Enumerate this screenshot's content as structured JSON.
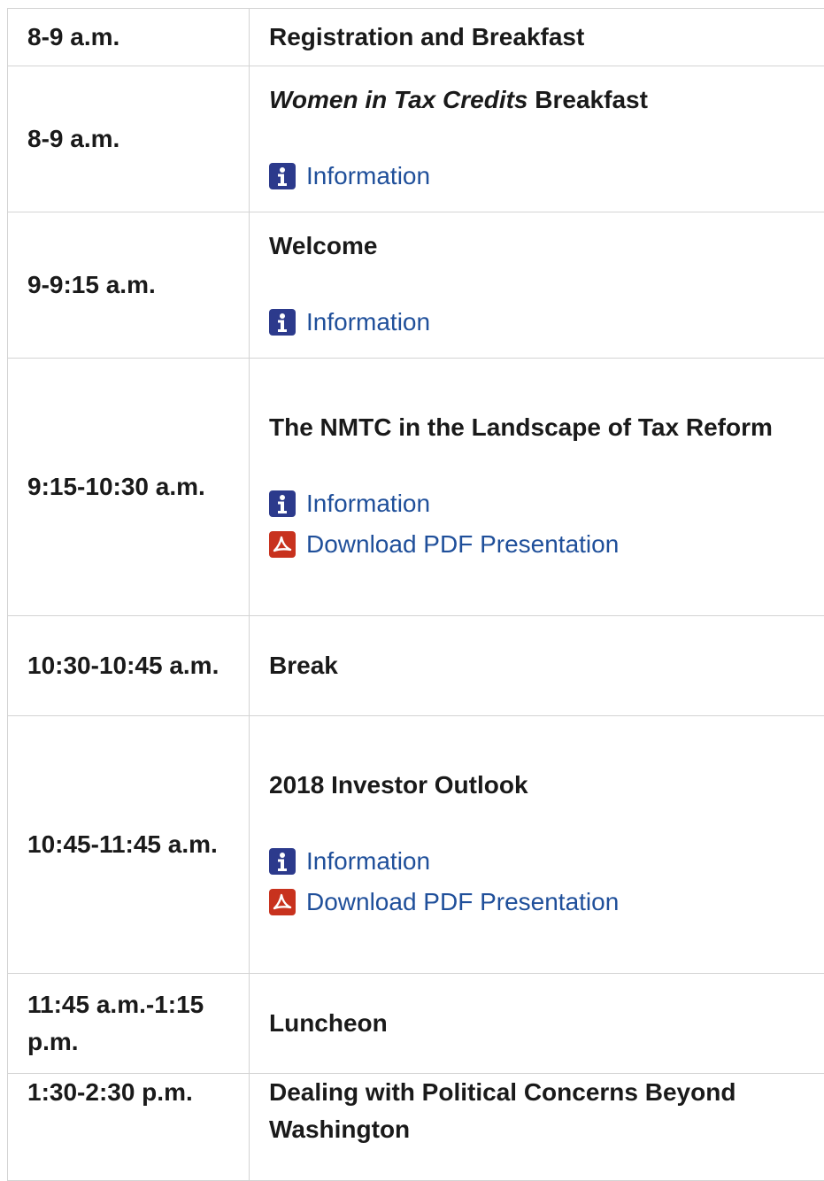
{
  "agenda": [
    {
      "time": "8-9 a.m.",
      "title_plain": "Registration and Breakfast"
    },
    {
      "time": "8-9 a.m.",
      "title_italic": "Women in Tax Credits",
      "title_rest": " Breakfast",
      "info_label": "Information"
    },
    {
      "time": "9-9:15 a.m.",
      "title_plain": "Welcome",
      "info_label": "Information"
    },
    {
      "time": "9:15-10:30 a.m.",
      "title_plain": "The NMTC in the Landscape of Tax Reform",
      "info_label": "Information",
      "pdf_label": "Download PDF Presentation"
    },
    {
      "time": "10:30-10:45 a.m.",
      "title_plain": "Break"
    },
    {
      "time": "10:45-11:45 a.m.",
      "title_plain": "2018 Investor Outlook",
      "info_label": "Information",
      "pdf_label": "Download PDF Presentation"
    },
    {
      "time": "11:45 a.m.-1:15 p.m.",
      "title_plain": "Luncheon"
    },
    {
      "time": "1:30-2:30 p.m.",
      "title_plain": "Dealing with Political Concerns Beyond Washington"
    }
  ],
  "icons": {
    "info": "info-icon",
    "pdf": "pdf-icon"
  },
  "colors": {
    "link": "#1f4f9a",
    "info_icon_bg": "#2c3a8c",
    "pdf_icon_bg": "#c8321e",
    "border": "#d4d4d4"
  }
}
